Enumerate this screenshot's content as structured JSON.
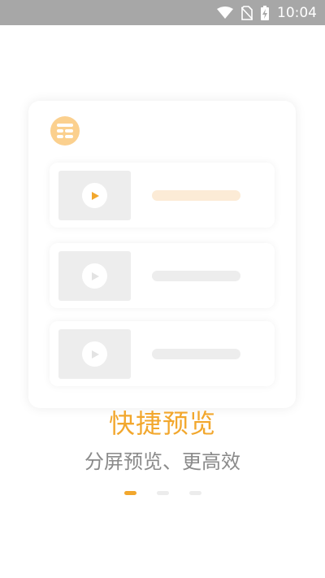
{
  "status_bar": {
    "time": "10:04",
    "icons": [
      "wifi-icon",
      "no-sim-icon",
      "battery-charging-icon"
    ],
    "color": "#a7a7a7"
  },
  "illustration": {
    "badge_icon": "grid-list-icon",
    "rows": [
      {
        "highlighted": true
      },
      {
        "highlighted": false
      },
      {
        "highlighted": false
      }
    ]
  },
  "onboarding": {
    "title": "快捷预览",
    "subtitle": "分屏预览、更高效",
    "page_indicator": {
      "pages": 3,
      "active_index": 0
    }
  },
  "colors": {
    "accent": "#f2a72d",
    "badge": "#fbd08e",
    "highlight_bar": "#fcebd6",
    "placeholder": "#ededed",
    "subtitle_text": "#8a8a8a"
  }
}
